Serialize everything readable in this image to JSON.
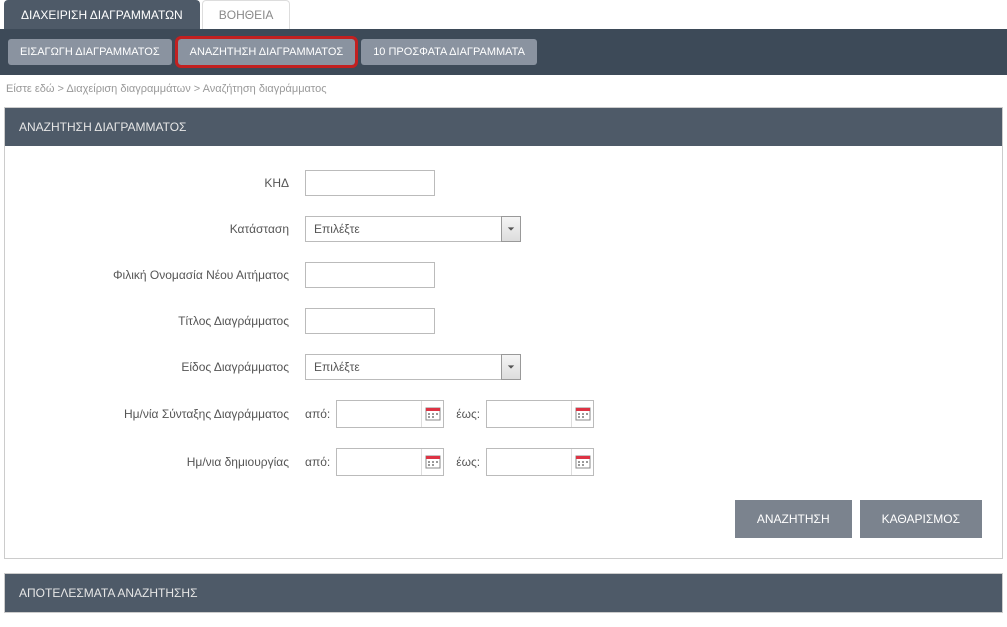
{
  "top_tabs": {
    "manage": "ΔΙΑΧΕΙΡΙΣΗ ΔΙΑΓΡΑΜΜΑΤΩΝ",
    "help": "ΒΟΗΘΕΙΑ"
  },
  "sub_tabs": {
    "insert": "ΕΙΣΑΓΩΓΗ ΔΙΑΓΡΑΜΜΑΤΟΣ",
    "search": "ΑΝΑΖΗΤΗΣΗ ΔΙΑΓΡΑΜΜΑΤΟΣ",
    "recent": "10 ΠΡΟΣΦΑΤΑ ΔΙΑΓΡΑΜΜΑΤΑ"
  },
  "breadcrumb": "Είστε εδώ > Διαχείριση διαγραμμάτων > Αναζήτηση διαγράμματος",
  "panel": {
    "search_title": "ΑΝΑΖΗΤΗΣΗ ΔΙΑΓΡΑΜΜΑΤΟΣ",
    "results_title": "ΑΠΟΤΕΛΕΣΜΑΤΑ ΑΝΑΖΗΤΗΣΗΣ"
  },
  "form": {
    "khd_label": "ΚΗΔ",
    "status_label": "Κατάσταση",
    "status_value": "Επιλέξτε",
    "friendly_name_label": "Φιλική Ονομασία Νέου Αιτήματος",
    "diagram_title_label": "Τίτλος Διαγράμματος",
    "diagram_type_label": "Είδος Διαγράμματος",
    "diagram_type_value": "Επιλέξτε",
    "compose_date_label": "Ημ/νία Σύνταξης Διαγράμματος",
    "create_date_label": "Ημ/νια δημιουργίας",
    "from_label": "από:",
    "to_label": "έως:"
  },
  "buttons": {
    "search": "ΑΝΑΖΗΤΗΣΗ",
    "clear": "ΚΑΘΑΡΙΣΜΟΣ"
  }
}
